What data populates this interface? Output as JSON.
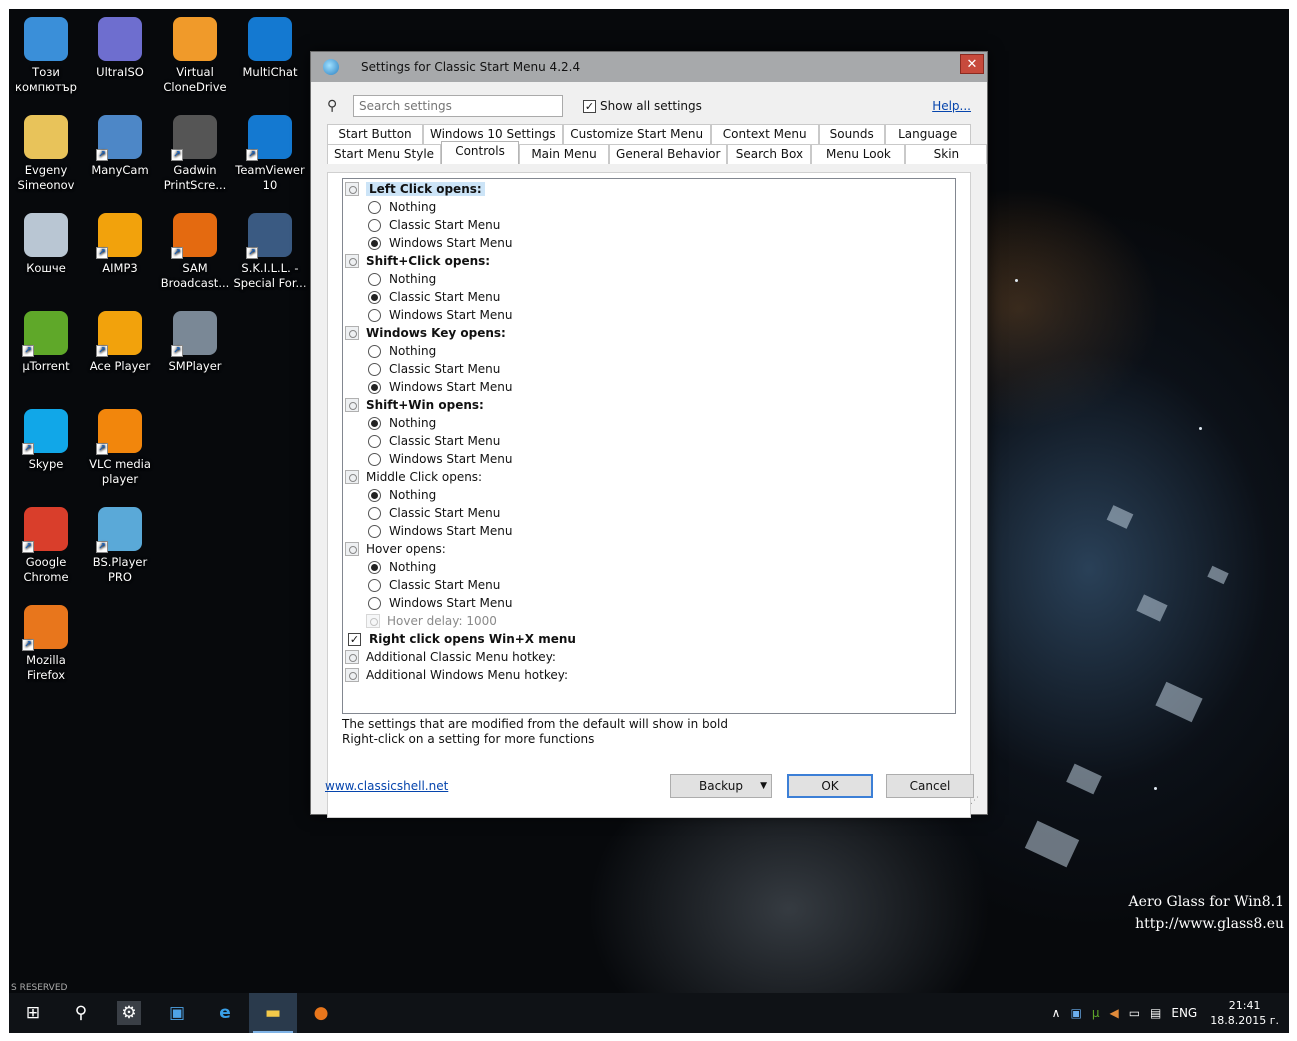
{
  "desktop": {
    "icons": [
      {
        "label": "Този\nкомпютър",
        "icon": "computer-icon",
        "color": "#3a8fd9"
      },
      {
        "label": "UltraISO",
        "icon": "disc-icon",
        "color": "#6e6ecf"
      },
      {
        "label": "Virtual\nCloneDrive",
        "icon": "sheep-icon",
        "color": "#f09a2a"
      },
      {
        "label": "MultiChat",
        "icon": "teamviewer-icon",
        "color": "#1479d1"
      },
      {
        "label": "Evgeny\nSimeonov",
        "icon": "user-folder-icon",
        "color": "#e8c35a"
      },
      {
        "label": "ManyCam",
        "icon": "manycam-icon",
        "color": "#4d87c7"
      },
      {
        "label": "Gadwin\nPrintScre...",
        "icon": "camera-icon",
        "color": "#555555"
      },
      {
        "label": "TeamViewer\n10",
        "icon": "teamviewer-icon",
        "color": "#1479d1"
      },
      {
        "label": "Кошче",
        "icon": "recycle-bin-icon",
        "color": "#b9c6d3"
      },
      {
        "label": "AIMP3",
        "icon": "aimp-icon",
        "color": "#f2a20c"
      },
      {
        "label": "SAM\nBroadcast...",
        "icon": "sam-broadcaster-icon",
        "color": "#e46a10"
      },
      {
        "label": "S.K.I.L.L. -\nSpecial For...",
        "icon": "game-icon",
        "color": "#3a5a82"
      },
      {
        "label": "µTorrent",
        "icon": "utorrent-icon",
        "color": "#5fa829"
      },
      {
        "label": "Ace Player",
        "icon": "vlc-icon",
        "color": "#f2a20c"
      },
      {
        "label": "SMPlayer",
        "icon": "smplayer-icon",
        "color": "#7a8896"
      },
      {
        "label": "Skype",
        "icon": "skype-icon",
        "color": "#11a7e8"
      },
      {
        "label": "VLC media\nplayer",
        "icon": "vlc-icon",
        "color": "#f2860c"
      },
      {
        "label": "Google\nChrome",
        "icon": "chrome-icon",
        "color": "#d93e2b"
      },
      {
        "label": "BS.Player\nPRO",
        "icon": "bsplayer-icon",
        "color": "#5aa9d8"
      },
      {
        "label": "Mozilla\nFirefox",
        "icon": "firefox-icon",
        "color": "#e8761c"
      }
    ],
    "watermark_line1": "Aero Glass for Win8.1",
    "watermark_line2": "http://www.glass8.eu",
    "corner_text": "S RESERVED"
  },
  "taskbar": {
    "lang": "ENG",
    "time": "21:41",
    "date": "18.8.2015 г."
  },
  "dialog": {
    "title": "Settings for Classic Start Menu 4.2.4",
    "close_label": "✕",
    "search_placeholder": "Search settings",
    "show_all_label": "Show all settings",
    "help_label": "Help...",
    "tabs_row1": [
      "Start Button",
      "Windows 10 Settings",
      "Customize Start Menu",
      "Context Menu",
      "Sounds",
      "Language"
    ],
    "tabs_row2": [
      "Start Menu Style",
      "Controls",
      "Main Menu",
      "General Behavior",
      "Search Box",
      "Menu Look",
      "Skin"
    ],
    "active_tab": "Controls",
    "settings": [
      {
        "kind": "group",
        "label": "Left Click opens:",
        "bold": true,
        "selected": true
      },
      {
        "kind": "radio",
        "label": "Nothing",
        "checked": false
      },
      {
        "kind": "radio",
        "label": "Classic Start Menu",
        "checked": false
      },
      {
        "kind": "radio",
        "label": "Windows Start Menu",
        "checked": true
      },
      {
        "kind": "group",
        "label": "Shift+Click opens:",
        "bold": true
      },
      {
        "kind": "radio",
        "label": "Nothing",
        "checked": false
      },
      {
        "kind": "radio",
        "label": "Classic Start Menu",
        "checked": true
      },
      {
        "kind": "radio",
        "label": "Windows Start Menu",
        "checked": false
      },
      {
        "kind": "group",
        "label": "Windows Key opens:",
        "bold": true
      },
      {
        "kind": "radio",
        "label": "Nothing",
        "checked": false
      },
      {
        "kind": "radio",
        "label": "Classic Start Menu",
        "checked": false
      },
      {
        "kind": "radio",
        "label": "Windows Start Menu",
        "checked": true
      },
      {
        "kind": "group",
        "label": "Shift+Win opens:",
        "bold": true
      },
      {
        "kind": "radio",
        "label": "Nothing",
        "checked": true
      },
      {
        "kind": "radio",
        "label": "Classic Start Menu",
        "checked": false
      },
      {
        "kind": "radio",
        "label": "Windows Start Menu",
        "checked": false
      },
      {
        "kind": "group",
        "label": "Middle Click opens:",
        "bold": false
      },
      {
        "kind": "radio",
        "label": "Nothing",
        "checked": true
      },
      {
        "kind": "radio",
        "label": "Classic Start Menu",
        "checked": false
      },
      {
        "kind": "radio",
        "label": "Windows Start Menu",
        "checked": false
      },
      {
        "kind": "group",
        "label": "Hover opens:",
        "bold": false
      },
      {
        "kind": "radio",
        "label": "Nothing",
        "checked": true
      },
      {
        "kind": "radio",
        "label": "Classic Start Menu",
        "checked": false
      },
      {
        "kind": "radio",
        "label": "Windows Start Menu",
        "checked": false
      },
      {
        "kind": "disabled",
        "label": "Hover delay: 1000"
      },
      {
        "kind": "checkbox",
        "label": "Right click opens Win+X menu",
        "checked": true,
        "bold": true
      },
      {
        "kind": "group",
        "label": "Additional Classic Menu hotkey:",
        "bold": false
      },
      {
        "kind": "group",
        "label": "Additional Windows Menu hotkey:",
        "bold": false
      }
    ],
    "note_line1": "The settings that are modified from the default will show in bold",
    "note_line2": "Right-click on a setting for more functions",
    "site_link": "www.classicshell.net",
    "backup_label": "Backup",
    "ok_label": "OK",
    "cancel_label": "Cancel"
  }
}
